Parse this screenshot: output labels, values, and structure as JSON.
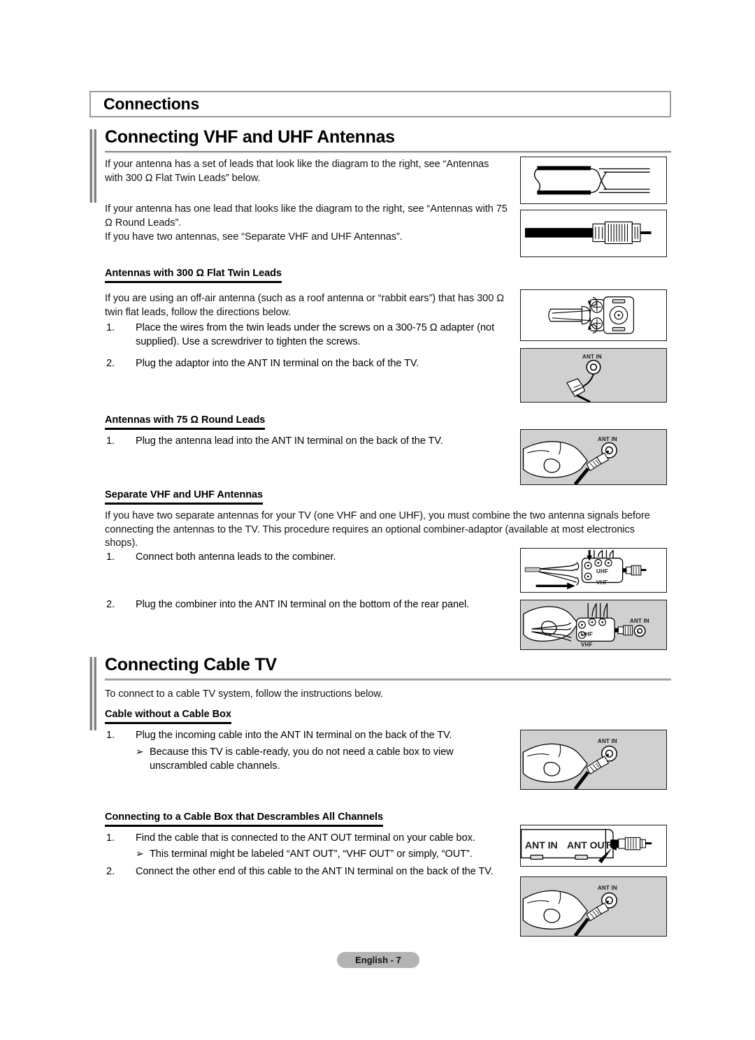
{
  "chapter": {
    "title": "Connections"
  },
  "footer": {
    "page_label": "English - 7"
  },
  "sections": [
    {
      "id": "vhf-uhf",
      "heading": "Connecting VHF and UHF Antennas",
      "intro": [
        "If your antenna has a set of leads that look like the diagram to the right, see “Antennas with 300 Ω Flat Twin Leads” below.",
        "If your antenna has one lead that looks like the diagram to the right, see “Antennas with 75 Ω Round Leads”.",
        "If you have two antennas, see “Separate VHF and UHF Antennas”."
      ],
      "subsections": [
        {
          "id": "flat-twin",
          "heading": "Antennas with 300 Ω Flat Twin Leads",
          "paragraph": "If you are using an off-air antenna (such as a roof antenna or “rabbit ears”) that has 300 Ω twin flat leads, follow the directions below.",
          "steps": [
            {
              "num": "1.",
              "text": "Place the wires from the twin leads under the screws on a 300-75 Ω adapter (not supplied). Use a screwdriver to tighten the screws."
            },
            {
              "num": "2.",
              "text": "Plug the adaptor into the ANT IN terminal on the back of the TV."
            }
          ]
        },
        {
          "id": "round-leads",
          "heading": "Antennas with 75 Ω Round Leads",
          "steps": [
            {
              "num": "1.",
              "text": "Plug the antenna lead into the ANT IN terminal on the back of the TV."
            }
          ]
        },
        {
          "id": "separate",
          "heading": "Separate VHF and UHF Antennas",
          "paragraph": "If you have two separate antennas for your TV (one VHF and one UHF), you must combine the two antenna signals before connecting the antennas to the TV. This procedure requires an optional combiner-adaptor (available at most electronics shops).",
          "steps": [
            {
              "num": "1.",
              "text": "Connect both antenna leads to the combiner."
            },
            {
              "num": "2.",
              "text": "Plug the combiner into the ANT IN terminal on the bottom of the rear panel."
            }
          ]
        }
      ]
    },
    {
      "id": "cable-tv",
      "heading": "Connecting Cable TV",
      "intro": [
        "To connect to a cable TV system, follow the instructions below."
      ],
      "subsections": [
        {
          "id": "no-box",
          "heading": "Cable without a Cable Box",
          "steps": [
            {
              "num": "1.",
              "text": "Plug the incoming cable into the ANT IN terminal on the back of the TV."
            }
          ],
          "notes": [
            {
              "bullet": "➢",
              "text": "Because this TV is cable-ready, you do not need a cable box to view unscrambled cable channels."
            }
          ]
        },
        {
          "id": "with-box",
          "heading": "Connecting to a Cable Box that Descrambles All Channels",
          "steps": [
            {
              "num": "1.",
              "text": "Find the cable that is connected to the ANT OUT terminal on your cable box."
            },
            {
              "num": "2.",
              "text": "Connect the other end of this cable to the ANT IN terminal on the back of the TV."
            }
          ],
          "notes": [
            {
              "bullet": "➢",
              "text": "This terminal might be labeled “ANT OUT”, “VHF OUT” or simply, “OUT”."
            }
          ]
        }
      ]
    }
  ],
  "figures": [
    {
      "id": "flat-twin-lead",
      "kind": "flat-twin-cable",
      "background": "#ffffff",
      "captions": []
    },
    {
      "id": "round-lead",
      "kind": "coax-connector",
      "background": "#ffffff",
      "captions": []
    },
    {
      "id": "adapter-300-75",
      "kind": "adapter-300-75",
      "background": "#ffffff",
      "captions": []
    },
    {
      "id": "adapter-to-ant-in",
      "kind": "adapter-to-antin",
      "background": "#d0d0d0",
      "captions": [
        "ANT IN"
      ]
    },
    {
      "id": "hand-coax-antin-1",
      "kind": "hand-coax-antin",
      "background": "#d0d0d0",
      "captions": [
        "ANT IN"
      ]
    },
    {
      "id": "combiner",
      "kind": "combiner",
      "background": "#ffffff",
      "captions": [
        "UHF",
        "VHF"
      ]
    },
    {
      "id": "combiner-antin",
      "kind": "combiner-antin",
      "background": "#d0d0d0",
      "captions": [
        "UHF",
        "VHF",
        "ANT IN"
      ]
    },
    {
      "id": "hand-coax-antin-2",
      "kind": "hand-coax-antin",
      "background": "#d0d0d0",
      "captions": [
        "ANT IN"
      ]
    },
    {
      "id": "cable-box-rear",
      "kind": "cable-box-rear",
      "background": "#ffffff",
      "captions": [
        "ANT IN",
        "ANT OUT"
      ]
    },
    {
      "id": "hand-coax-antin-3",
      "kind": "hand-coax-antin",
      "background": "#d0d0d0",
      "captions": [
        "ANT IN"
      ]
    }
  ],
  "colors": {
    "rule_gray": "#9a9a9a",
    "figure_gray": "#d0d0d0",
    "footer_pill": "#b3b3b3",
    "ink": "#000000"
  }
}
